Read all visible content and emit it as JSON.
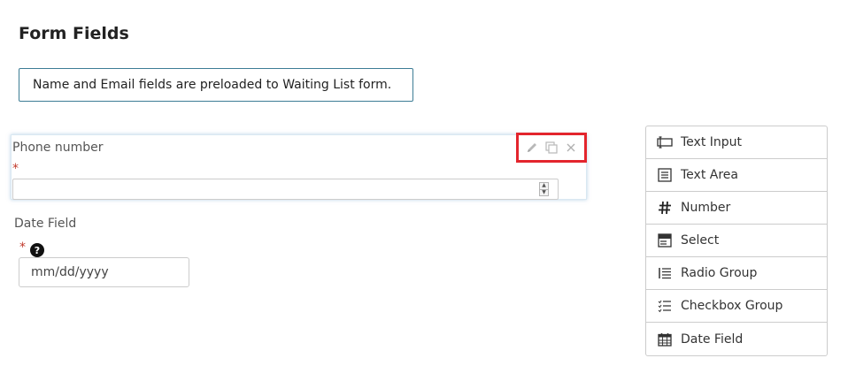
{
  "page": {
    "title": "Form Fields",
    "notice": "Name and Email fields are preloaded to Waiting List form."
  },
  "phone_field": {
    "label": "Phone number",
    "required_mark": "*",
    "value": "",
    "spinner_up": "▲",
    "spinner_down": "▼",
    "actions": [
      {
        "icon": "pencil-icon",
        "name": "edit"
      },
      {
        "icon": "copy-icon",
        "name": "duplicate"
      },
      {
        "icon": "close-icon",
        "name": "delete"
      }
    ]
  },
  "date_field": {
    "label": "Date Field",
    "required_mark": "*",
    "help_glyph": "?",
    "placeholder": "mm/dd/yyyy"
  },
  "palette": {
    "items": [
      {
        "label": "Text Input",
        "icon": "text-input-icon"
      },
      {
        "label": "Text Area",
        "icon": "text-area-icon"
      },
      {
        "label": "Number",
        "icon": "hash-icon"
      },
      {
        "label": "Select",
        "icon": "select-icon"
      },
      {
        "label": "Radio Group",
        "icon": "radio-group-icon"
      },
      {
        "label": "Checkbox Group",
        "icon": "checkbox-group-icon"
      },
      {
        "label": "Date Field",
        "icon": "calendar-icon"
      }
    ]
  },
  "colors": {
    "accent_border": "#3d7d95",
    "highlight_red": "#e3252d",
    "required_red": "#c0392b"
  }
}
